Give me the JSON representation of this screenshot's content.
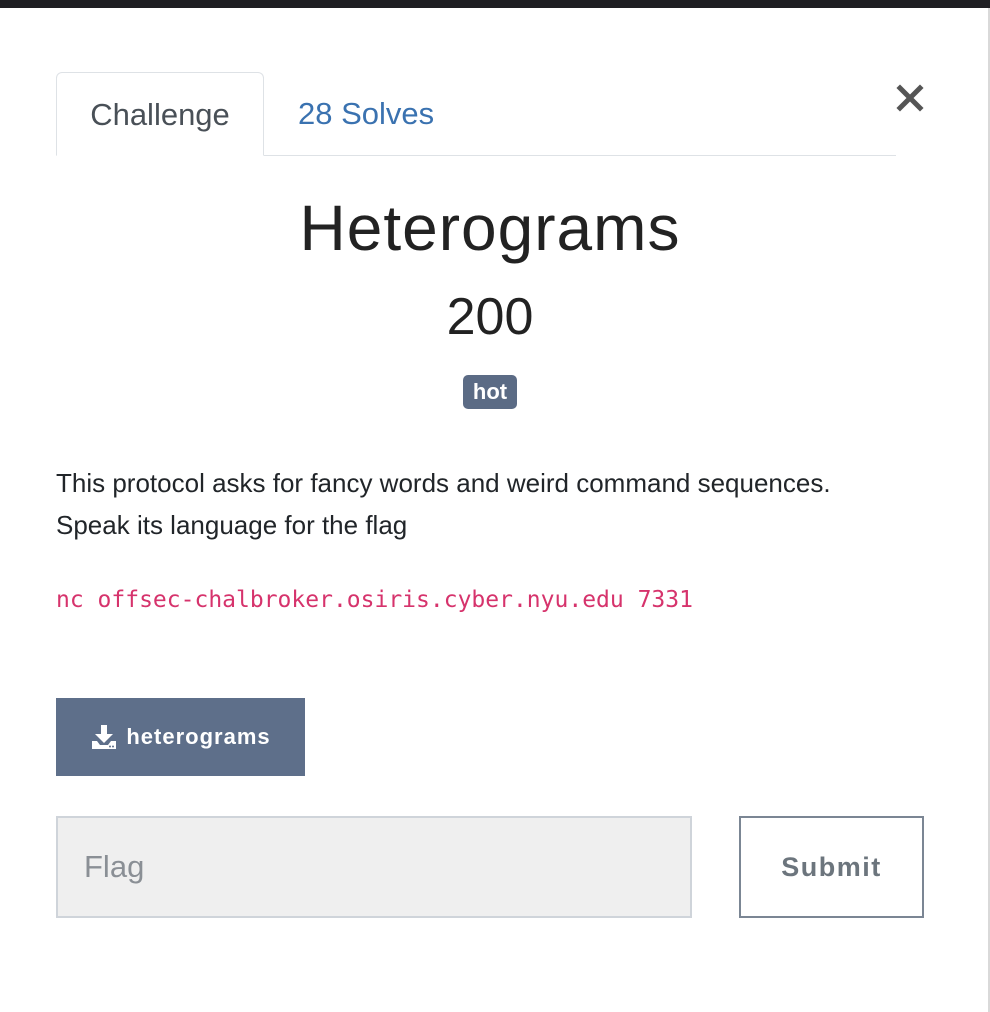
{
  "tabs": {
    "challenge_label": "Challenge",
    "solves_label": "28 Solves"
  },
  "challenge": {
    "name": "Heterograms",
    "points": "200",
    "tag": "hot",
    "description_line1": "This protocol asks for fancy words and weird command sequences.",
    "description_line2": "Speak its language for the flag",
    "command": "nc offsec-chalbroker.osiris.cyber.nyu.edu 7331"
  },
  "files": {
    "download_label": "heterograms"
  },
  "submission": {
    "flag_placeholder": "Flag",
    "flag_value": "",
    "submit_label": "Submit"
  },
  "icons": {
    "close": "close-icon",
    "download": "download-icon"
  },
  "colors": {
    "tag_bg": "#5b6b85",
    "button_bg": "#5e6f8a",
    "link": "#3a72b0",
    "code": "#d6336c"
  }
}
